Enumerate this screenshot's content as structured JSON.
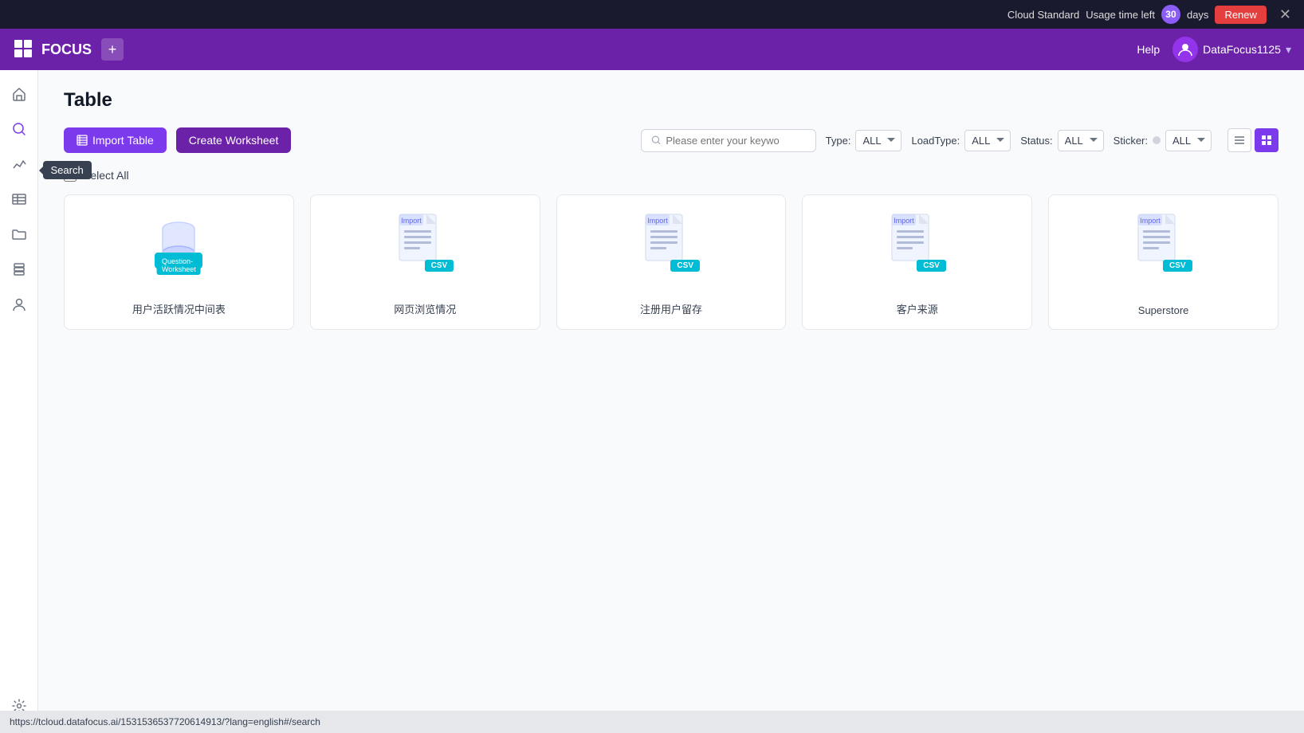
{
  "topbar": {
    "plan": "Cloud Standard",
    "usage_label": "Usage time left",
    "days": "30",
    "days_unit": "days",
    "renew_label": "Renew"
  },
  "header": {
    "logo_text": "FOCUS",
    "help_label": "Help",
    "user_label": "DataFocus1125"
  },
  "page": {
    "title": "Table"
  },
  "toolbar": {
    "import_label": "Import Table",
    "create_label": "Create Worksheet",
    "search_placeholder": "Please enter your keywo",
    "type_label": "Type:",
    "type_value": "ALL",
    "loadtype_label": "LoadType:",
    "loadtype_value": "ALL",
    "status_label": "Status:",
    "status_value": "ALL",
    "sticker_label": "Sticker:",
    "sticker_value": "ALL"
  },
  "select_all": "Select All",
  "search_tooltip": "Search",
  "cards": [
    {
      "id": 1,
      "name": "用户活跃情况中间表",
      "type": "worksheet",
      "badge": "Question-Worksheet"
    },
    {
      "id": 2,
      "name": "网页浏览情况",
      "type": "csv",
      "badge": "CSV"
    },
    {
      "id": 3,
      "name": "注册用户留存",
      "type": "csv",
      "badge": "CSV"
    },
    {
      "id": 4,
      "name": "客户来源",
      "type": "csv",
      "badge": "CSV"
    },
    {
      "id": 5,
      "name": "Superstore",
      "type": "csv",
      "badge": "CSV"
    }
  ],
  "status_bar_url": "https://tcloud.datafocus.ai/153153653772061​4913/?lang=english#/search",
  "sidebar_items": [
    {
      "id": "home",
      "icon": "⌂",
      "label": "Home"
    },
    {
      "id": "search",
      "icon": "⊙",
      "label": "Search"
    },
    {
      "id": "analytics",
      "icon": "📈",
      "label": "Analytics"
    },
    {
      "id": "table",
      "icon": "▦",
      "label": "Table"
    },
    {
      "id": "folder",
      "icon": "📁",
      "label": "Folder"
    },
    {
      "id": "data",
      "icon": "🗄",
      "label": "Data"
    },
    {
      "id": "user",
      "icon": "👤",
      "label": "User"
    },
    {
      "id": "settings",
      "icon": "⚙",
      "label": "Settings"
    }
  ]
}
